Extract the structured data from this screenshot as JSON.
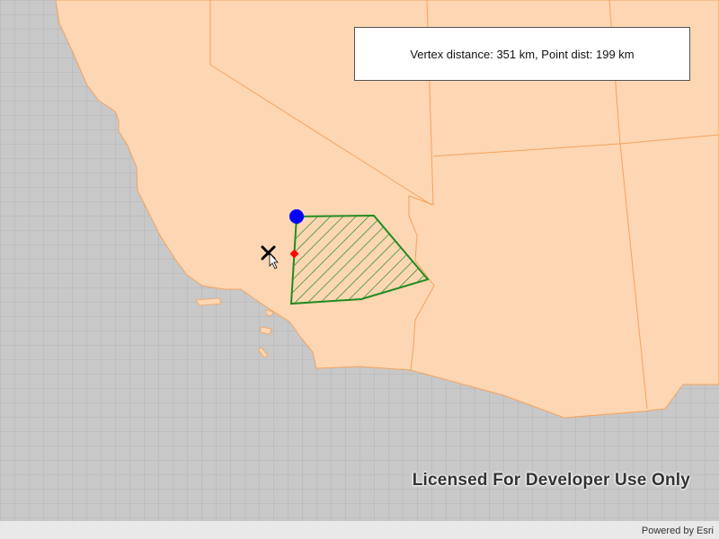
{
  "info": {
    "text": "Vertex distance: 351 km, Point dist: 199 km"
  },
  "map": {
    "watermark": "Licensed For Developer Use Only",
    "attribution": "Powered by Esri",
    "colors": {
      "land": "#fdd6b3",
      "ocean": "#c8c8c8",
      "grid": "#b0b0b0",
      "border": "#f3a35e",
      "polygon": "#228b22",
      "nearest_vertex": "#0000ff",
      "nearest_point": "#ff0000",
      "tap_marker": "#000000"
    }
  }
}
